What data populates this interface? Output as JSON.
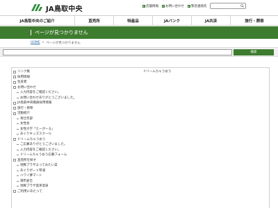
{
  "header": {
    "logo_text": "JA鳥取中央",
    "util_links": [
      "店舗情報",
      "お問い合わせ",
      "緊急連絡先"
    ]
  },
  "gnav": [
    "JA鳥取中央のご紹介",
    "直売所",
    "特産品",
    "JAバンク",
    "JA共済",
    "旅行・葬祭"
  ],
  "page": {
    "title": "ページが見つかりません",
    "breadcrumb_home": "HOME",
    "breadcrumb_sep": "»",
    "breadcrumb_current": "ページが見つかりません"
  },
  "search": {
    "value": "",
    "button_label": "検索"
  },
  "sitemap": {
    "left": [
      {
        "level": 1,
        "label": "リンク集"
      },
      {
        "level": 1,
        "label": "採用情報"
      },
      {
        "level": 1,
        "label": "生産者"
      },
      {
        "level": 1,
        "label": "お問い合わせ"
      },
      {
        "level": 2,
        "label": "入力内容をご確認ください。"
      },
      {
        "level": 2,
        "label": "お問い合わせありがとうございました。"
      },
      {
        "level": 1,
        "label": "JA鳥取中央職員採用情報"
      },
      {
        "level": 1,
        "label": "旅行・葬祭"
      },
      {
        "level": 1,
        "label": "活動紹介"
      },
      {
        "level": 2,
        "label": "青壮年部"
      },
      {
        "level": 2,
        "label": "女性会"
      },
      {
        "level": 2,
        "label": "女性大学「えーがーる」"
      },
      {
        "level": 2,
        "label": "あぐりキッズスクール"
      },
      {
        "level": 1,
        "label": "ドリームちゃうおう"
      },
      {
        "level": 2,
        "label": "ご応募ありがとうございました。"
      },
      {
        "level": 2,
        "label": "入力内容をご確認ください。"
      },
      {
        "level": 2,
        "label": "ドリームちゃうおう応募フォーム"
      },
      {
        "level": 1,
        "label": "直売所を探す"
      },
      {
        "level": 2,
        "label": "地鮮プラザよってみたい菜"
      },
      {
        "level": 2,
        "label": "あぐりポート琴浦"
      },
      {
        "level": 2,
        "label": "ハワイ夢マート"
      },
      {
        "level": 2,
        "label": "潮市倉吉"
      },
      {
        "level": 2,
        "label": "地鮮プラザ奥津温泉"
      },
      {
        "level": 1,
        "label": "ご利用にあたって"
      }
    ],
    "right": [
      {
        "level": 0,
        "label": "ドリームちゃうおう"
      }
    ]
  }
}
